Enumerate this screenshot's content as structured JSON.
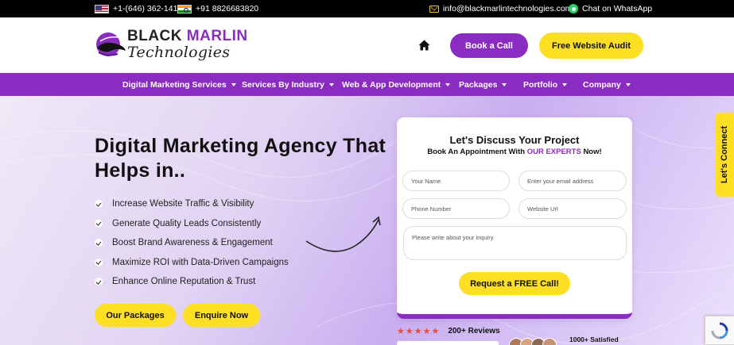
{
  "topbar": {
    "phone_us": "+1-(646) 362-1414",
    "phone_in": "+91 8826683820",
    "email": "info@blackmarlintechnologies.com",
    "whatsapp": "Chat on WhatsApp"
  },
  "header": {
    "logo_line1_a": "BLACK",
    "logo_line1_b": "MARLIN",
    "logo_line2": "Technologies",
    "book_call": "Book a Call",
    "free_audit": "Free Website Audit"
  },
  "nav": {
    "items": [
      {
        "label": "Digital Marketing Services"
      },
      {
        "label": "Services By Industry"
      },
      {
        "label": "Web & App Development"
      },
      {
        "label": "Packages"
      },
      {
        "label": "Portfolio"
      },
      {
        "label": "Company"
      }
    ]
  },
  "hero": {
    "headline_line1": "Digital Marketing Agency That",
    "headline_line2": "Helps in..",
    "bullets": [
      "Increase Website Traffic & Visibility",
      "Generate Quality Leads Consistently",
      "Boost Brand Awareness & Engagement",
      "Maximize ROI with Data-Driven Campaigns",
      "Enhance Online Reputation & Trust"
    ],
    "btn_packages": "Our Packages",
    "btn_enquire": "Enquire Now"
  },
  "form": {
    "title": "Let's Discuss Your Project",
    "subtitle_pre": "Book An Appointment With",
    "subtitle_highlight": "OUR EXPERTS",
    "subtitle_post": "Now!",
    "name_placeholder": "Your Name",
    "email_placeholder": "Enter your email address",
    "phone_placeholder": "Phone Number",
    "url_placeholder": "Website Url",
    "inquiry_placeholder": "Please write about your inquiry",
    "submit": "Request a FREE Call!"
  },
  "reviews": {
    "stars": "★★★★★",
    "count": "200+ Reviews",
    "satisfied": "1000+ Satisfied"
  },
  "side_tab": "Let's Connect",
  "colors": {
    "purple": "#8a2bc2",
    "yellow": "#ffdf23",
    "black": "#000000"
  }
}
